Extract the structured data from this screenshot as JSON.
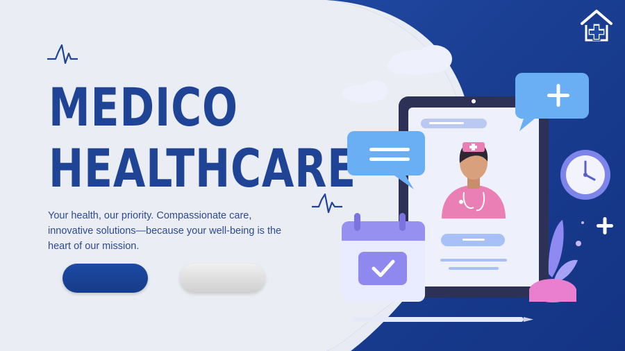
{
  "brand": {
    "title_line1": "MEDICO",
    "title_line2": "HEALTHCARE",
    "tagline": "Your health, our priority. Compassionate care, innovative solutions—because your well-being is the heart of our mission."
  },
  "colors": {
    "primary": "#1f4496",
    "accent_blue": "#1a3f93",
    "light_bg": "#eaedf4",
    "secondary_pill": "#d9d9d9"
  },
  "icons": {
    "logo": "home-medical-cross-icon",
    "pulse": "heartbeat-pulse-icon",
    "calendar": "calendar-check-icon",
    "clock": "clock-icon",
    "plus": "plus-icon",
    "chat": "chat-bubble-icon",
    "doctor": "doctor-avatar-icon"
  }
}
